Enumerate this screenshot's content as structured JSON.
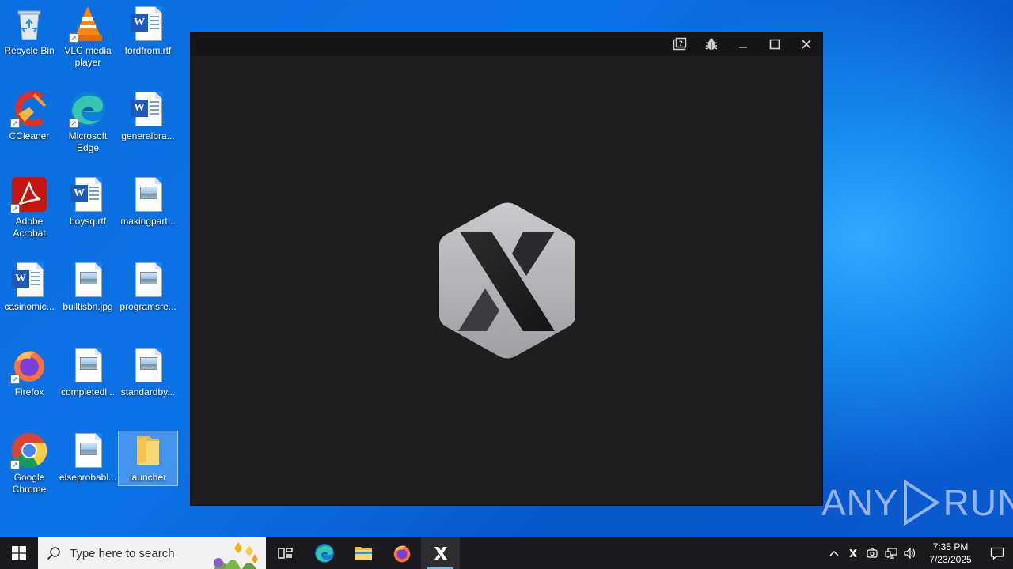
{
  "desktop": {
    "icons": [
      {
        "label": "Recycle Bin"
      },
      {
        "label": "VLC media player"
      },
      {
        "label": "fordfrom.rtf"
      },
      {
        "label": "CCleaner"
      },
      {
        "label": "Microsoft Edge"
      },
      {
        "label": "generalbra..."
      },
      {
        "label": "Adobe Acrobat"
      },
      {
        "label": "boysq.rtf"
      },
      {
        "label": "makingpart..."
      },
      {
        "label": "casinomic..."
      },
      {
        "label": "builtisbn.jpg"
      },
      {
        "label": "programsre..."
      },
      {
        "label": "Firefox"
      },
      {
        "label": "completedl..."
      },
      {
        "label": "standardby..."
      },
      {
        "label": "Google Chrome"
      },
      {
        "label": "elseprobabl..."
      },
      {
        "label": "launcher"
      }
    ]
  },
  "window": {
    "buttons": [
      "help-icon",
      "bug-icon",
      "minimize-icon",
      "maximize-icon",
      "close-icon"
    ],
    "logo_letter": "X"
  },
  "watermark": {
    "left": "ANY",
    "right": "RUN"
  },
  "taskbar": {
    "search_placeholder": "Type here to search",
    "apps": [
      "task-view-icon",
      "edge-icon",
      "file-explorer-icon",
      "firefox-icon",
      "x-launcher-icon"
    ],
    "clock_time": "7:35 PM",
    "clock_date": "7/23/2025"
  },
  "colors": {
    "desktop_blue": "#0b72e6",
    "window_bg": "#1e1e1e",
    "taskbar_bg": "#1a1a1c",
    "accent": "#76b9ed"
  }
}
